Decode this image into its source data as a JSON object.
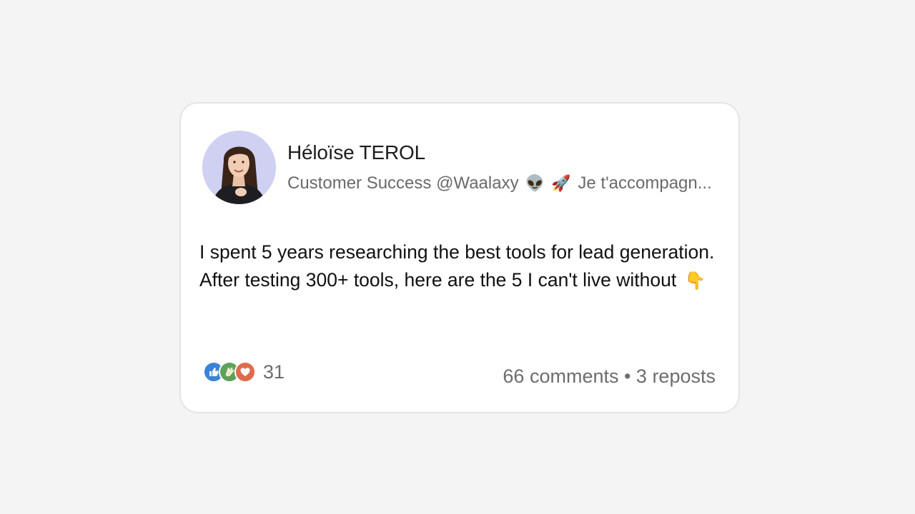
{
  "post": {
    "author": {
      "name": "Héloïse TEROL",
      "headline_start": "Customer Success @Waalaxy",
      "headline_emojis": [
        "👽",
        "🚀"
      ],
      "headline_end": "Je t'accompagn..."
    },
    "text": "I spent 5 years researching the best tools for lead generation. After testing 300+ tools, here are the 5 I can't live without",
    "text_emoji": "👇",
    "reactions": {
      "types": [
        "like-icon",
        "celebrate-icon",
        "love-icon"
      ],
      "count": "31"
    },
    "engagement": "66 comments • 3 reposts"
  },
  "colors": {
    "background": "#f4f4f4",
    "card": "#ffffff",
    "avatar_bg": "#cfd0f2",
    "like": "#3a83d6",
    "celebrate": "#5da25a",
    "love": "#e06a4c"
  }
}
